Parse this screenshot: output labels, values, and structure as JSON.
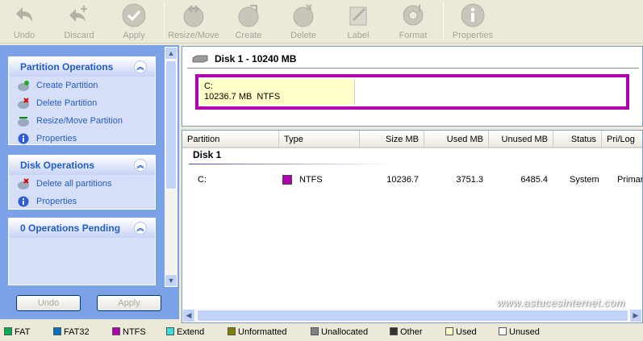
{
  "toolbar": {
    "undo": "Undo",
    "discard": "Discard",
    "apply": "Apply",
    "resize_move": "Resize/Move",
    "create": "Create",
    "delete": "Delete",
    "label": "Label",
    "format": "Format",
    "properties": "Properties"
  },
  "sidebar": {
    "partition_ops": {
      "title": "Partition Operations",
      "items": [
        "Create Partition",
        "Delete Partition",
        "Resize/Move Partition",
        "Properties"
      ]
    },
    "disk_ops": {
      "title": "Disk Operations",
      "items": [
        "Delete all partitions",
        "Properties"
      ]
    },
    "pending": {
      "title": "0 Operations Pending"
    },
    "undo_button": "Undo",
    "apply_button": "Apply"
  },
  "disk": {
    "header": "Disk 1 - 10240 MB",
    "partition_label": "C:",
    "partition_info": "10236.7 MB  NTFS"
  },
  "table": {
    "columns": [
      "Partition",
      "Type",
      "Size MB",
      "Used MB",
      "Unused MB",
      "Status",
      "Pri/Log"
    ],
    "group": "Disk 1",
    "rows": [
      {
        "partition": "C:",
        "type": "NTFS",
        "size": "10236.7",
        "used": "3751.3",
        "unused": "6485.4",
        "status": "System",
        "prilog": "Primary"
      }
    ]
  },
  "legend": [
    {
      "label": "FAT",
      "color": "#00b050"
    },
    {
      "label": "FAT32",
      "color": "#0070c0"
    },
    {
      "label": "NTFS",
      "color": "#b100b1"
    },
    {
      "label": "Extend",
      "color": "#33e0e0"
    },
    {
      "label": "Unformatted",
      "color": "#808000"
    },
    {
      "label": "Unallocated",
      "color": "#808080"
    },
    {
      "label": "Other",
      "color": "#333333"
    },
    {
      "label": "Used",
      "color": "#ffffc8"
    },
    {
      "label": "Unused",
      "color": "#ffffff"
    }
  ],
  "watermark": "www.astucesinternet.com"
}
